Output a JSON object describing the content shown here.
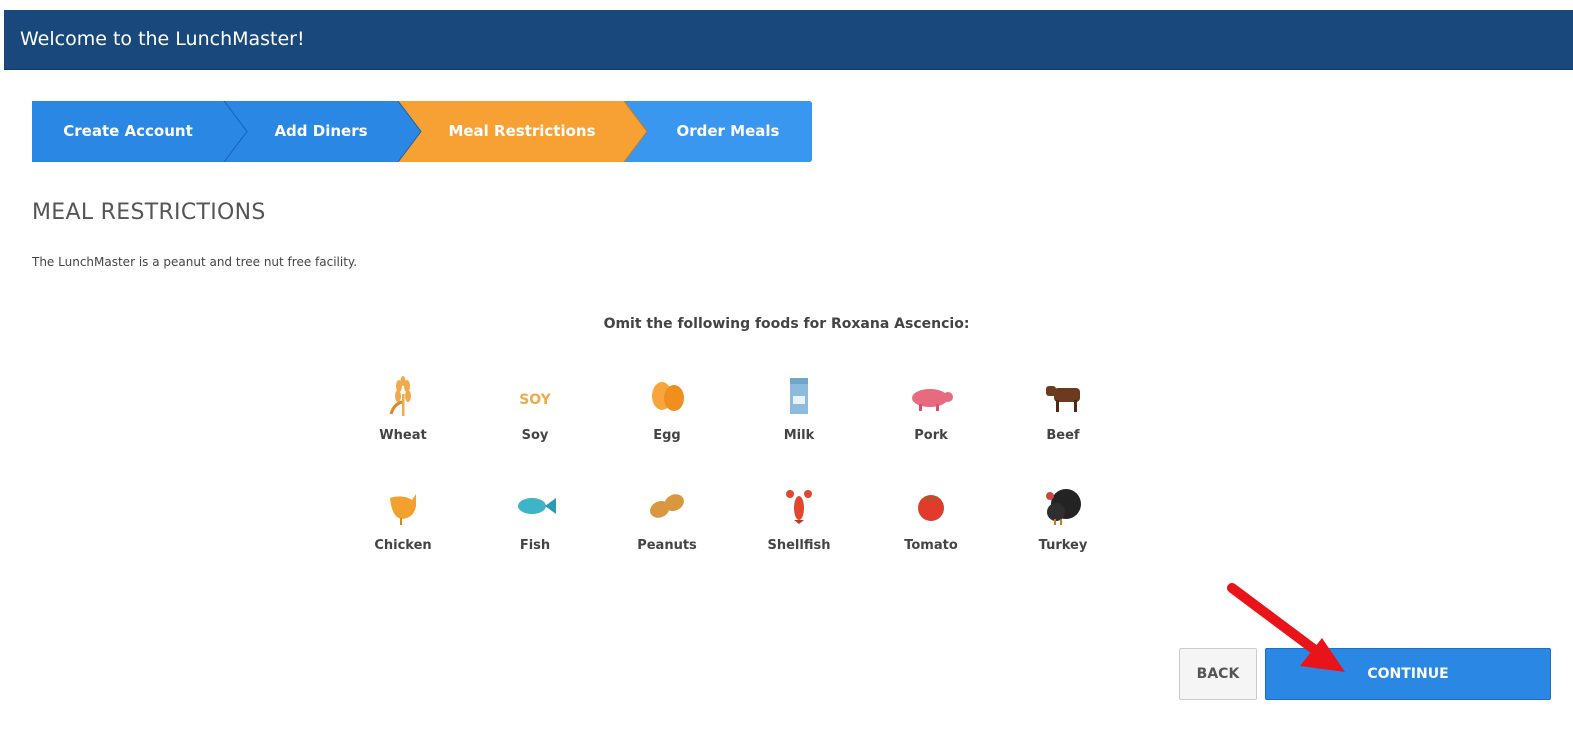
{
  "header": {
    "title": "Welcome to the LunchMaster!"
  },
  "wizard": {
    "steps": [
      {
        "label": "Create Account",
        "state": "done"
      },
      {
        "label": "Add Diners",
        "state": "done"
      },
      {
        "label": "Meal Restrictions",
        "state": "active"
      },
      {
        "label": "Order Meals",
        "state": "upcoming"
      }
    ],
    "colors": {
      "done": "#2a87e4",
      "active": "#f7a135",
      "upcoming": "#3a97f0"
    }
  },
  "section": {
    "title": "MEAL RESTRICTIONS",
    "note": "The LunchMaster is a peanut and tree nut free facility.",
    "omit_label": "Omit the following foods for Roxana Ascencio:"
  },
  "foods": [
    {
      "label": "Wheat",
      "icon": "wheat-icon"
    },
    {
      "label": "Soy",
      "icon": "soy-icon",
      "icon_text": "SOY"
    },
    {
      "label": "Egg",
      "icon": "egg-icon"
    },
    {
      "label": "Milk",
      "icon": "milk-carton-icon"
    },
    {
      "label": "Pork",
      "icon": "pig-icon"
    },
    {
      "label": "Beef",
      "icon": "cow-icon"
    },
    {
      "label": "Chicken",
      "icon": "chicken-icon"
    },
    {
      "label": "Fish",
      "icon": "fish-icon"
    },
    {
      "label": "Peanuts",
      "icon": "peanut-icon"
    },
    {
      "label": "Shellfish",
      "icon": "lobster-icon"
    },
    {
      "label": "Tomato",
      "icon": "tomato-icon"
    },
    {
      "label": "Turkey",
      "icon": "turkey-icon"
    }
  ],
  "actions": {
    "back_label": "BACK",
    "continue_label": "CONTINUE"
  },
  "annotation": {
    "arrow_color": "#e8141a"
  }
}
